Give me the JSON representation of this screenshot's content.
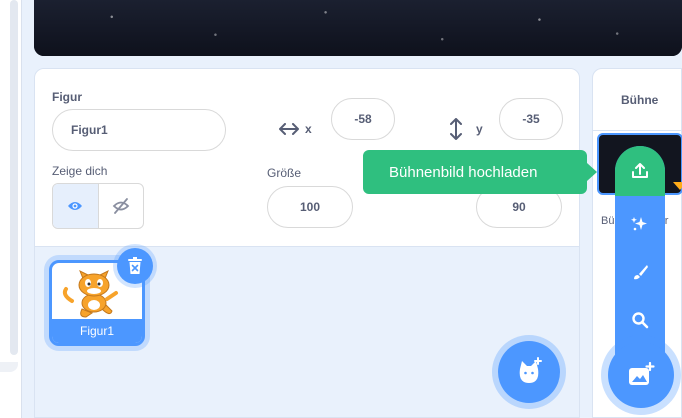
{
  "sprite_info": {
    "sprite_label": "Figur",
    "sprite_name": "Figur1",
    "x_label": "x",
    "x_value": "-58",
    "y_label": "y",
    "y_value": "-35",
    "show_label": "Zeige dich",
    "size_label": "Größe",
    "size_value": "100",
    "direction_value": "90"
  },
  "sprites": [
    {
      "name": "Figur1"
    }
  ],
  "stage_panel": {
    "title": "Bühne",
    "sub_label": "Bü",
    "sub_label_tail": "der"
  },
  "tooltip": {
    "text": "Bühnenbild hochladen"
  },
  "icons": {
    "x_axis": "horizontal-arrows-icon",
    "y_axis": "vertical-arrows-icon",
    "show": "eye-icon",
    "hide": "eye-slash-icon",
    "delete": "trash-icon",
    "upload": "upload-icon",
    "surprise": "sparkle-icon",
    "paint": "brush-icon",
    "search": "magnifier-icon",
    "choose_backdrop": "image-plus-icon",
    "choose_sprite": "cat-plus-icon"
  },
  "colors": {
    "primary": "#4c97ff",
    "tooltip": "#2fbf7f",
    "text": "#575e75"
  }
}
